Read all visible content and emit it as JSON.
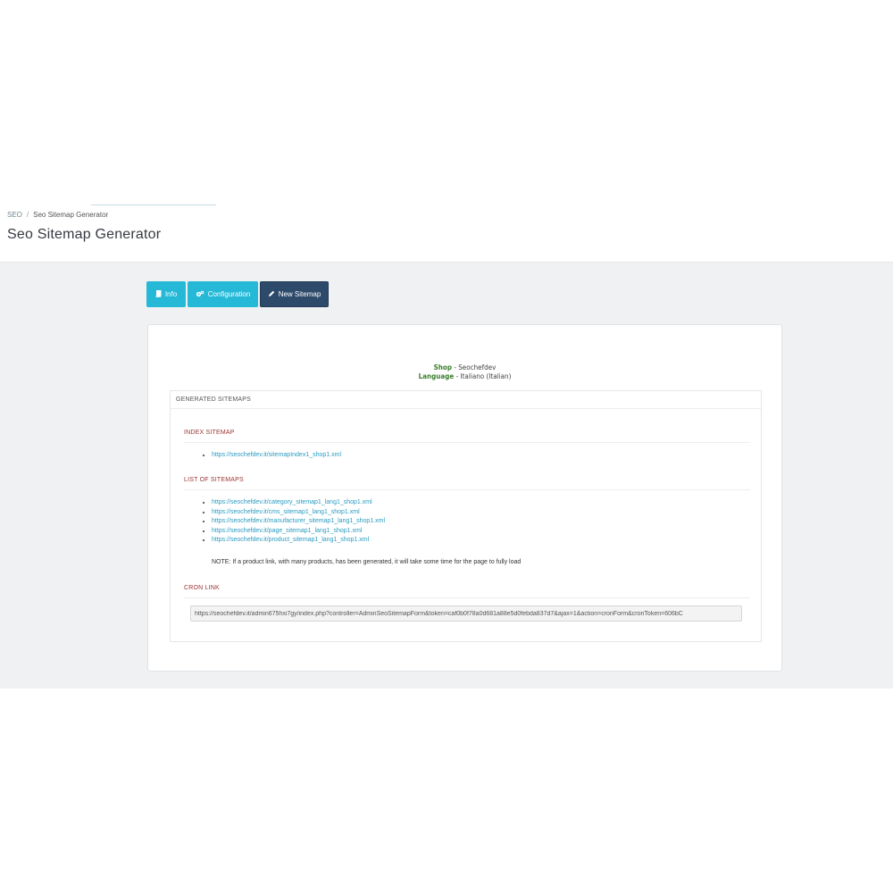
{
  "breadcrumb": {
    "root": "SEO",
    "separator": "/",
    "current": "Seo Sitemap Generator"
  },
  "page_title": "Seo Sitemap Generator",
  "toolbar": {
    "info_label": "Info",
    "config_label": "Configuration",
    "new_sitemap_label": "New Sitemap"
  },
  "shop": {
    "shop_label": "Shop",
    "shop_value": "- Seochefdev",
    "language_label": "Language",
    "language_value": "- Italiano (Italian)"
  },
  "generated": {
    "heading": "GENERATED SITEMAPS",
    "index_title": "INDEX SITEMAP",
    "index_links": [
      "https://seochefdev.it/sitemapIndex1_shop1.xml"
    ],
    "list_title": "LIST OF SITEMAPS",
    "list_links": [
      "https://seochefdev.it/category_sitemap1_lang1_shop1.xml",
      "https://seochefdev.it/cms_sitemap1_lang1_shop1.xml",
      "https://seochefdev.it/manufacturer_sitemap1_lang1_shop1.xml",
      "https://seochefdev.it/page_sitemap1_lang1_shop1.xml",
      "https://seochefdev.it/product_sitemap1_lang1_shop1.xml"
    ],
    "note": "NOTE: If a product link, with many products, has been generated, it will take some time for the page to fully load",
    "cron_title": "CRON LINK",
    "cron_value": "https://seochefdev.it/admin675hxi7gy/index.php?controller=AdminSeoSitemapForm&token=caf0b0f78a0d681a88e5d0febda837d7&ajax=1&action=cronForm&cronToken=606bC"
  },
  "colors": {
    "toolbar_primary": "#25b9d7",
    "toolbar_active": "#2e4a6b",
    "section_title": "#9c3434",
    "label_green": "#3a7d2c",
    "link": "#2a9bc1"
  }
}
